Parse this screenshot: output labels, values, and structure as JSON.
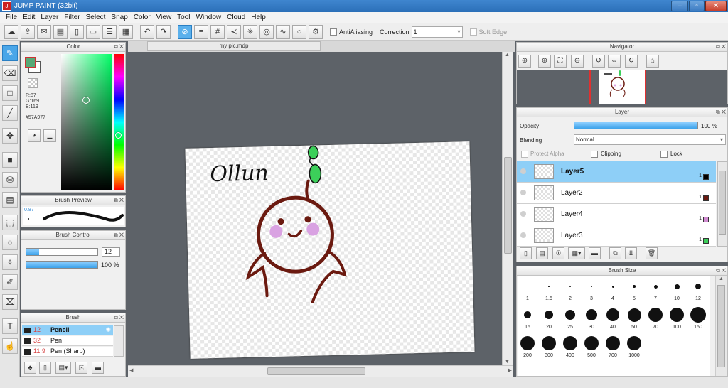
{
  "window": {
    "title": "JUMP PAINT (32bit)",
    "app_icon": "jump-paint-logo-icon",
    "controls": [
      "–",
      "▫",
      "✕"
    ]
  },
  "menu": [
    "File",
    "Edit",
    "Layer",
    "Filter",
    "Select",
    "Snap",
    "Color",
    "View",
    "Tool",
    "Window",
    "Cloud",
    "Help"
  ],
  "toolbar": {
    "antialiasing_label": "AntiAliasing",
    "correction_label": "Correction",
    "correction_value": "1",
    "soft_edge_label": "Soft Edge"
  },
  "color_panel": {
    "title": "Color",
    "r": "R:87",
    "g": "G:169",
    "b": "B:119",
    "hex": "#57A977",
    "primary": "#57A977",
    "secondary": "#ffffff"
  },
  "brush_preview": {
    "title": "Brush Preview",
    "size": "0.87"
  },
  "brush_control": {
    "title": "Brush Control",
    "size_value": "12",
    "opacity_value": "100 %",
    "size_fill": 0.18,
    "opacity_fill": 1.0
  },
  "brush": {
    "title": "Brush",
    "items": [
      {
        "size": "12",
        "name": "Pencil",
        "selected": true
      },
      {
        "size": "32",
        "name": "Pen",
        "selected": false
      },
      {
        "size": "11.9",
        "name": "Pen (Sharp)",
        "selected": false
      }
    ]
  },
  "document": {
    "tab": "my pic.mdp",
    "signature": "Ollun"
  },
  "navigator": {
    "title": "Navigator"
  },
  "layer_panel": {
    "title": "Layer",
    "opacity_label": "Opacity",
    "opacity_value": "100 %",
    "opacity_fill": 1.0,
    "blending_label": "Blending",
    "blending_value": "Normal",
    "protect_alpha": "Protect Alpha",
    "clipping": "Clipping",
    "lock": "Lock",
    "layers": [
      {
        "name": "Layer5",
        "num": "1",
        "color": "#000000",
        "selected": true
      },
      {
        "name": "Layer2",
        "num": "1",
        "color": "#6b1a10",
        "selected": false
      },
      {
        "name": "Layer4",
        "num": "1",
        "color": "#d08ad0",
        "selected": false
      },
      {
        "name": "Layer3",
        "num": "1",
        "color": "#3ccf5a",
        "selected": false
      }
    ]
  },
  "brush_size": {
    "title": "Brush Size",
    "sizes": [
      "1",
      "1.5",
      "2",
      "3",
      "4",
      "5",
      "7",
      "10",
      "12",
      "15",
      "20",
      "25",
      "30",
      "40",
      "50",
      "70",
      "100",
      "150",
      "200",
      "300",
      "400",
      "500",
      "700",
      "1000"
    ]
  },
  "colors": {
    "accent": "#4aa6e8",
    "stroke": "#6b1a10",
    "leaf": "#3ccf5a",
    "cheek": "#d9a2e2"
  }
}
